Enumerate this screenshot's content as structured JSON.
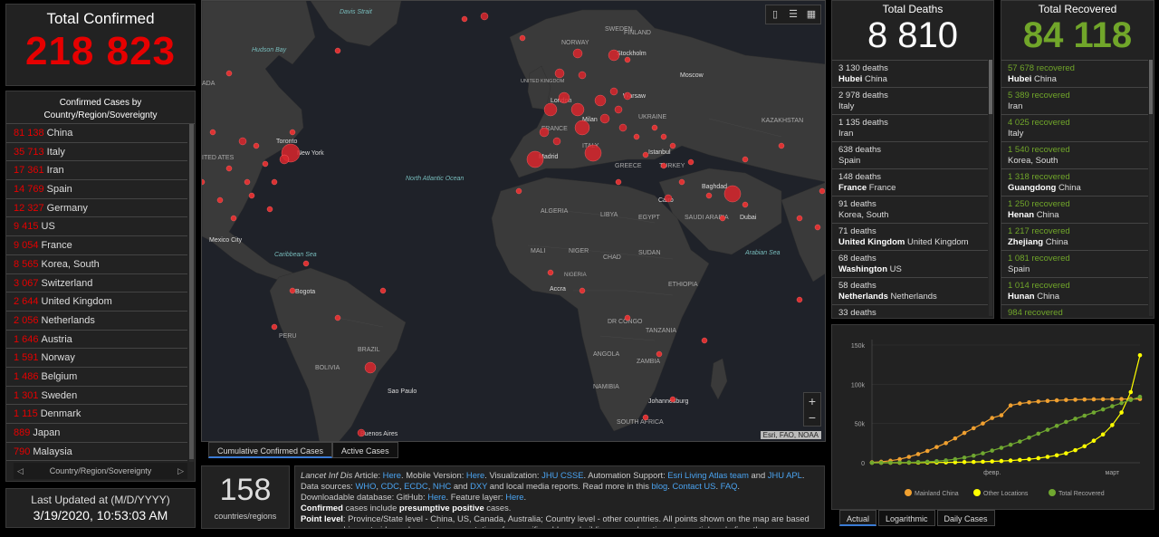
{
  "total_confirmed": {
    "title": "Total Confirmed",
    "value": "218 823"
  },
  "confirmed_list": {
    "header": "Confirmed Cases by Country/Region/Sovereignty",
    "rows": [
      {
        "value": "81 138",
        "name": "China"
      },
      {
        "value": "35 713",
        "name": "Italy"
      },
      {
        "value": "17 361",
        "name": "Iran"
      },
      {
        "value": "14 769",
        "name": "Spain"
      },
      {
        "value": "12 327",
        "name": "Germany"
      },
      {
        "value": "9 415",
        "name": "US"
      },
      {
        "value": "9 054",
        "name": "France"
      },
      {
        "value": "8 565",
        "name": "Korea, South"
      },
      {
        "value": "3 067",
        "name": "Switzerland"
      },
      {
        "value": "2 644",
        "name": "United Kingdom"
      },
      {
        "value": "2 056",
        "name": "Netherlands"
      },
      {
        "value": "1 646",
        "name": "Austria"
      },
      {
        "value": "1 591",
        "name": "Norway"
      },
      {
        "value": "1 486",
        "name": "Belgium"
      },
      {
        "value": "1 301",
        "name": "Sweden"
      },
      {
        "value": "1 115",
        "name": "Denmark"
      },
      {
        "value": "889",
        "name": "Japan"
      },
      {
        "value": "790",
        "name": "Malaysia"
      }
    ],
    "pager_label": "Country/Region/Sovereignty"
  },
  "last_updated": {
    "label": "Last Updated at (M/D/YYYY)",
    "value": "3/19/2020, 10:53:03 AM"
  },
  "map": {
    "labels": [
      "Davis Strait",
      "Hudson Bay",
      "ADA",
      "Toronto",
      "New York",
      "ITED ATES",
      "Mexico City",
      "Caribbean Sea",
      "Bogota",
      "PERU",
      "BOLIVIA",
      "BRAZIL",
      "Sao Paulo",
      "Buenos Aires",
      "North Atlantic Ocean",
      "SWEDEN",
      "FINLAND",
      "NORWAY",
      "Stockholm",
      "UNITED KINGDOM",
      "London",
      "Warsaw",
      "Moscow",
      "UKRAINE",
      "KAZAKHSTAN",
      "FRANCE",
      "Milan",
      "Madrid",
      "Istanbul",
      "ITALY",
      "GREECE",
      "TURKEY",
      "Baghdad",
      "Cairo",
      "SAUDI ARABIA",
      "Dubai",
      "EGYPT",
      "LIBYA",
      "ALGERIA",
      "MALI",
      "NIGER",
      "CHAD",
      "SUDAN",
      "NIGERIA",
      "ETHIOPIA",
      "Accra",
      "DR CONGO",
      "TANZANIA",
      "ANGOLA",
      "ZAMBIA",
      "NAMIBIA",
      "Johannesburg",
      "SOUTH AFRICA",
      "Arabian Sea"
    ],
    "attribution": "Esri, FAO, NOAA",
    "tabs": [
      "Cumulative Confirmed Cases",
      "Active Cases"
    ]
  },
  "count": {
    "value": "158",
    "label": "countries/regions"
  },
  "info": {
    "line1_prefix": "Lancet Inf Dis",
    "line1": " Article: ",
    "here": "Here",
    "mobile": ". Mobile Version: ",
    "viz": ". Visualization: ",
    "jhu_csse": "JHU CSSE",
    "auto": ". Automation Support: ",
    "esri_team": "Esri Living Atlas team",
    "and": " and ",
    "jhu_apl": "JHU APL",
    "period": ".",
    "sources_prefix": "Data sources: ",
    "who": "WHO",
    "cdc": "CDC",
    "ecdc": "ECDC",
    "nhc": "NHC",
    "dxy": "DXY",
    "sources_suffix": " and local media reports. Read more in this ",
    "blog": "blog",
    "contact": "Contact US",
    "faq": "FAQ",
    "download": "Downloadable database: GitHub: ",
    "feature": ". Feature layer: ",
    "confirmed_b": "Confirmed",
    "confirmed_rest": " cases include ",
    "presumptive_b": "presumptive positive",
    "cases": " cases.",
    "point_b": "Point level",
    "point_rest": ": Province/State level - China, US, Canada, Australia; Country level - other countries. All points shown on the map are based on geographic centroids, and are not representative of a specific address, building or any location at a spatial scale finer than a"
  },
  "deaths": {
    "title": "Total Deaths",
    "value": "8 810",
    "rows": [
      {
        "count": "3 130 deaths",
        "region": "Hubei",
        "country": "China"
      },
      {
        "count": "2 978 deaths",
        "region": "",
        "country": "Italy"
      },
      {
        "count": "1 135 deaths",
        "region": "",
        "country": "Iran"
      },
      {
        "count": "638 deaths",
        "region": "",
        "country": "Spain"
      },
      {
        "count": "148 deaths",
        "region": "France",
        "country": "France"
      },
      {
        "count": "91 deaths",
        "region": "",
        "country": "Korea, South"
      },
      {
        "count": "71 deaths",
        "region": "United Kingdom",
        "country": "United Kingdom"
      },
      {
        "count": "68 deaths",
        "region": "Washington",
        "country": "US"
      },
      {
        "count": "58 deaths",
        "region": "Netherlands",
        "country": "Netherlands"
      },
      {
        "count": "33 deaths",
        "region": "",
        "country": ""
      }
    ]
  },
  "recovered": {
    "title": "Total Recovered",
    "value": "84 118",
    "rows": [
      {
        "count": "57 678 recovered",
        "region": "Hubei",
        "country": "China"
      },
      {
        "count": "5 389 recovered",
        "region": "",
        "country": "Iran"
      },
      {
        "count": "4 025 recovered",
        "region": "",
        "country": "Italy"
      },
      {
        "count": "1 540 recovered",
        "region": "",
        "country": "Korea, South"
      },
      {
        "count": "1 318 recovered",
        "region": "Guangdong",
        "country": "China"
      },
      {
        "count": "1 250 recovered",
        "region": "Henan",
        "country": "China"
      },
      {
        "count": "1 217 recovered",
        "region": "Zhejiang",
        "country": "China"
      },
      {
        "count": "1 081 recovered",
        "region": "",
        "country": "Spain"
      },
      {
        "count": "1 014 recovered",
        "region": "Hunan",
        "country": "China"
      },
      {
        "count": "984 recovered",
        "region": "",
        "country": ""
      }
    ]
  },
  "chart_data": {
    "type": "line",
    "x": [
      0,
      2,
      4,
      6,
      8,
      10,
      12,
      14,
      16,
      18,
      20,
      22,
      24,
      26,
      28,
      30,
      32,
      34,
      36,
      38,
      40,
      42,
      44,
      46,
      48,
      50,
      52,
      54,
      56,
      58
    ],
    "x_tick_labels": [
      "февр.",
      "март"
    ],
    "y_tick_labels": [
      "0",
      "50k",
      "100k",
      "150k"
    ],
    "ylim": [
      0,
      150000
    ],
    "series": [
      {
        "name": "Mainland China",
        "color": "#f0a030",
        "values": [
          500,
          1200,
          2500,
          4500,
          7500,
          11000,
          15000,
          20000,
          25000,
          31000,
          38000,
          44000,
          50000,
          57000,
          60500,
          73000,
          75500,
          77000,
          78000,
          78800,
          79500,
          80000,
          80300,
          80600,
          80800,
          80900,
          81000,
          81100,
          81200,
          81200
        ]
      },
      {
        "name": "Other Locations",
        "color": "#ffff00",
        "values": [
          0,
          0,
          0,
          50,
          100,
          150,
          250,
          350,
          450,
          600,
          800,
          1000,
          1300,
          1700,
          2200,
          2800,
          3600,
          4500,
          5800,
          7500,
          9500,
          12000,
          16000,
          21000,
          28000,
          36000,
          48000,
          64000,
          90000,
          137000
        ]
      },
      {
        "name": "Total Recovered",
        "color": "#70a830",
        "values": [
          0,
          50,
          150,
          300,
          500,
          800,
          1300,
          2000,
          3000,
          4500,
          6500,
          9000,
          12000,
          15500,
          19000,
          23000,
          27000,
          32000,
          37000,
          42000,
          47000,
          52000,
          56000,
          60000,
          64000,
          68000,
          72000,
          76000,
          80000,
          84000
        ]
      }
    ],
    "tabs": [
      "Actual",
      "Logarithmic",
      "Daily Cases"
    ]
  }
}
